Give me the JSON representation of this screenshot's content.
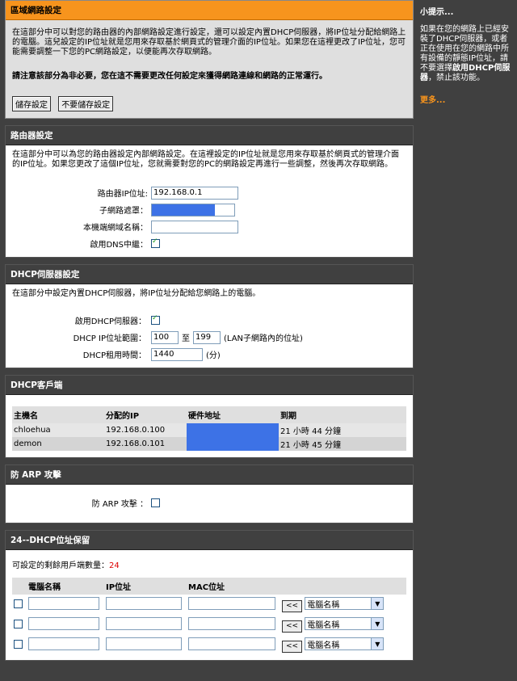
{
  "lan": {
    "title": "區域網路設定",
    "desc": "在這部分中可以對您的路由器的內部網路設定進行設定，還可以設定內置DHCP伺服器，將IP位址分配給網路上的電腦。這兒設定的IP位址就是您用來存取基於網頁式的管理介面的IP位址。如果您在這裡更改了IP位址，您可能需要調整一下您的PC網路設定，以便能再次存取網路。",
    "warning": "請注意該部分為非必要，您在這不需要更改任何設定來獲得網路連線和網路的正常運行。",
    "save_label": "儲存設定",
    "nosave_label": "不要儲存設定"
  },
  "router": {
    "title": "路由器設定",
    "desc": "在這部分中可以為您的路由器設定內部網路設定。在這裡設定的IP位址就是您用來存取基於網頁式的管理介面的IP位址。如果您更改了這個IP位址，您就需要對您的PC的網路設定再進行一些調整，然後再次存取網路。",
    "ip_label": "路由器IP位址:",
    "ip_value": "192.168.0.1",
    "mask_label": "子網路遮罩：",
    "domain_label": "本機端網域名稱：",
    "domain_value": "",
    "dns_label": "啟用DNS中繼："
  },
  "dhcp": {
    "title": "DHCP伺服器設定",
    "desc": "在這部分中設定內置DHCP伺服器，將IP位址分配給您網路上的電腦。",
    "enable_label": "啟用DHCP伺服器：",
    "range_label": "DHCP IP位址範圍：",
    "range_start": "100",
    "range_to": "至",
    "range_end": "199",
    "range_note": "(LAN子網路內的位址)",
    "lease_label": "DHCP租用時間：",
    "lease_value": "1440",
    "lease_unit": "(分)"
  },
  "clients": {
    "title": "DHCP客戶端",
    "headers": [
      "主機名",
      "分配的IP",
      "硬件地址",
      "到期"
    ],
    "rows": [
      {
        "host": "chloehua",
        "ip": "192.168.0.100",
        "mac": "",
        "expire": "21 小時 44 分鐘"
      },
      {
        "host": "demon",
        "ip": "192.168.0.101",
        "mac": "",
        "expire": "21 小時 45 分鐘"
      }
    ]
  },
  "arp": {
    "title": "防 ARP 攻擊",
    "label": "防 ARP 攻擊 ："
  },
  "reserve": {
    "title": "24--DHCP位址保留",
    "remaining_label": "可設定的剩餘用戶端數量：",
    "remaining_count": "24",
    "headers": [
      "電腦名稱",
      "IP位址",
      "MAC位址"
    ],
    "copy_label": "<<",
    "select_value": "電腦名稱"
  },
  "sidebar": {
    "title": "小提示...",
    "body_1": "如果在您的網路上已經安裝了DHCP伺服器，或者正在使用在您的網路中所有設備的靜態IP位址，請不要選擇",
    "body_bold": "啟用DHCP伺服器",
    "body_2": "，禁止該功能。",
    "more": "更多..."
  },
  "colors": {
    "accent": "#f7941d",
    "header_bg": "#404040",
    "highlight": "#3d72e6"
  }
}
